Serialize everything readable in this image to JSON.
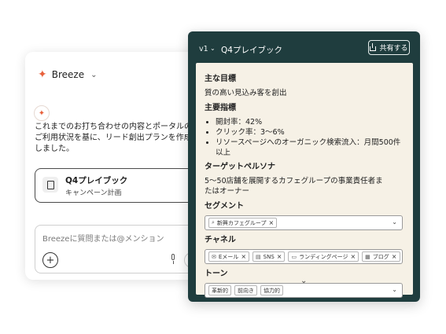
{
  "chat": {
    "app_name": "Breeze",
    "message": "これまでのお打ち合わせの内容とポータルのご利用状況を基に、リード創出プランを作成しました。",
    "playbook_card": {
      "title": "Q4プレイブック",
      "subtitle": "キャンペーン計画"
    },
    "input": {
      "placeholder": "Breezeに質問または@メンション"
    }
  },
  "panel": {
    "version": "v1",
    "title": "Q4プレイブック",
    "share_label": "共有する",
    "goal_heading": "主な目標",
    "goal_text": "質の高い見込み客を創出",
    "metrics_heading": "主要指標",
    "metrics": [
      "開封率：42%",
      "クリック率：3〜6%",
      "リソースページへのオーガニック検索流入：月間500件以上"
    ],
    "persona_heading": "ターゲットペルソナ",
    "persona_text": "5〜50店舗を展開するカフェグループの事業責任者またはオーナー",
    "segment_heading": "セグメント",
    "segments": [
      "新興カフェグループ"
    ],
    "channel_heading": "チャネル",
    "channels": [
      "Eメール",
      "SNS",
      "ランディングページ",
      "ブログ"
    ],
    "tone_heading": "トーン",
    "tones": [
      "革新的",
      "前向き",
      "協力的"
    ]
  },
  "colors": {
    "panel_bg": "#1f3d3e",
    "doc_bg": "#f6f1e6",
    "accent": "#e8613c"
  }
}
